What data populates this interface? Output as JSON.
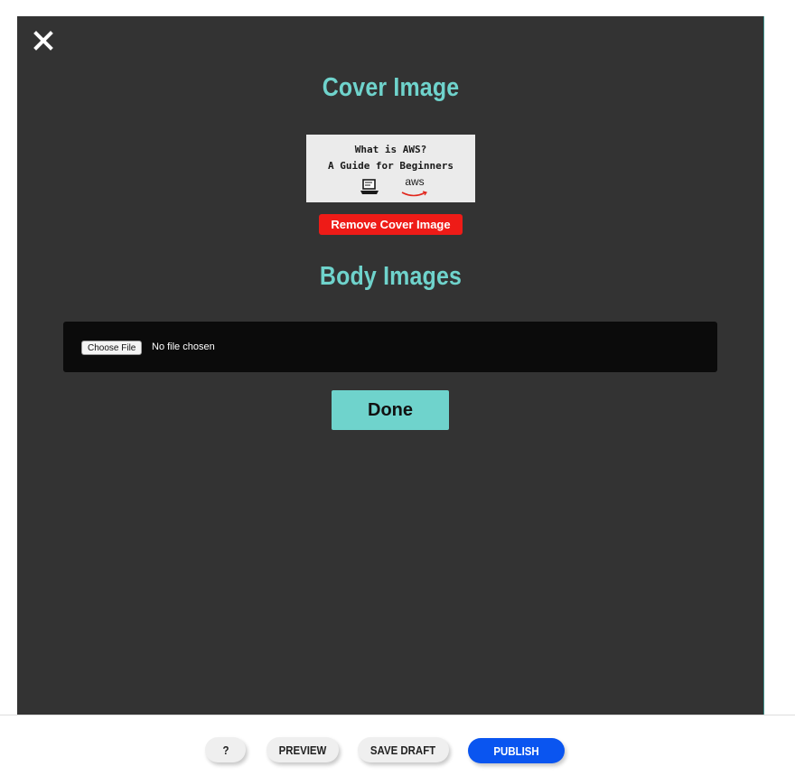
{
  "modal": {
    "close_icon": "close-icon",
    "cover_section": {
      "title": "Cover Image",
      "thumbnail": {
        "line1": "What is AWS?",
        "line2": "A Guide for Beginners",
        "logo_text": "aws",
        "icons": [
          "laptop-icon",
          "aws-logo"
        ]
      },
      "remove_label": "Remove Cover Image"
    },
    "body_section": {
      "title": "Body Images",
      "file_input": {
        "button_label": "Choose File",
        "status_text": "No file chosen"
      }
    },
    "done_label": "Done"
  },
  "toolbar": {
    "help_label": "?",
    "preview_label": "PREVIEW",
    "save_draft_label": "SAVE DRAFT",
    "publish_label": "PUBLISH"
  },
  "colors": {
    "modal_bg": "#333333",
    "accent": "#6fd3cc",
    "remove": "#ee1b17",
    "publish": "#0a55f0",
    "file_area_bg": "#0b0b0b"
  }
}
